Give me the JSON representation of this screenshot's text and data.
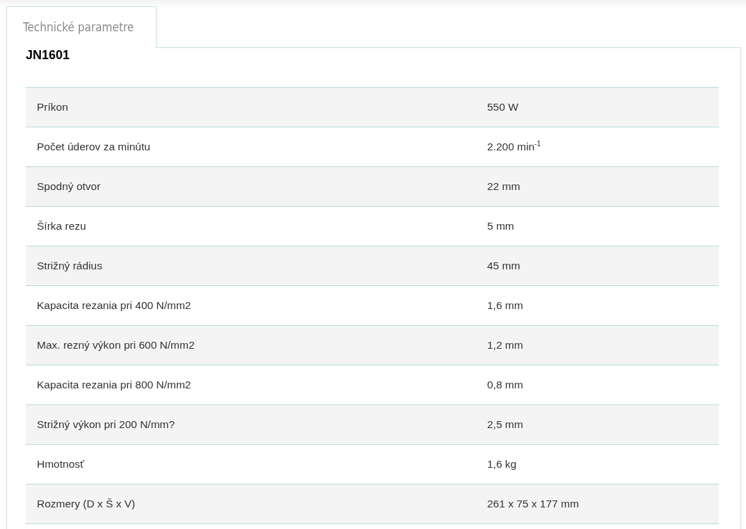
{
  "tabs": [
    {
      "label": "Technické parametre",
      "selected": true
    }
  ],
  "product_code": "JN1601",
  "table": {
    "rows": [
      {
        "label": "Príkon",
        "value": "550 W"
      },
      {
        "label": "Počet úderov za minútu",
        "value": "2.200 min$^{-1}$"
      },
      {
        "label": "Spodný otvor",
        "value": "22 mm"
      },
      {
        "label": "Šírka rezu",
        "value": "5 mm"
      },
      {
        "label": "Strižný rádius",
        "value": "45 mm"
      },
      {
        "label": "Kapacita rezania pri 400 N/mm2",
        "value": "1,6 mm"
      },
      {
        "label": "Max. rezný výkon pri 600 N/mm2",
        "value": "1,2 mm"
      },
      {
        "label": "Kapacita rezania pri 800 N/mm2",
        "value": "0,8 mm"
      },
      {
        "label": "Strižný výkon pri 200 N/mm?",
        "value": "2,5 mm"
      },
      {
        "label": "Hmotnosť",
        "value": "1,6 kg"
      },
      {
        "label": "Rozmery (D x Š x V)",
        "value": "261 x 75 x 177 mm"
      }
    ]
  }
}
